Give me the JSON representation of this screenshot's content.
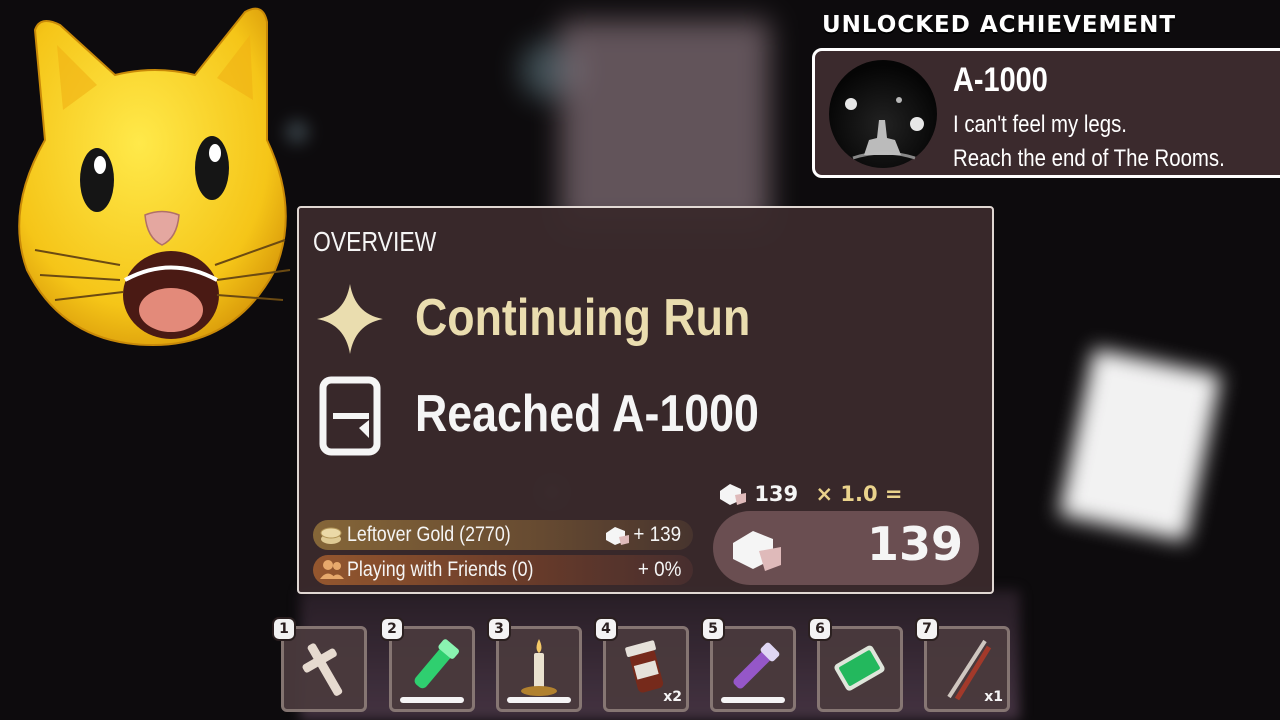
{
  "achievement": {
    "header": "UNLOCKED ACHIEVEMENT",
    "name": "A-1000",
    "line1": "I can't feel my legs.",
    "line2": "Reach the end of The Rooms."
  },
  "overview": {
    "title": "OVERVIEW",
    "rows": [
      {
        "label": "Continuing Run",
        "icon": "sparkle-icon",
        "color": "#f4e6b6"
      },
      {
        "label": "Reached A-1000",
        "icon": "door-icon",
        "color": "#ffffff"
      }
    ],
    "bonuses": [
      {
        "label": "Leftover Gold (2770)",
        "value": "+ 139",
        "icon": "gold-coins-icon"
      },
      {
        "label": "Playing with Friends (0)",
        "value": "+ 0%",
        "icon": "friends-icon"
      }
    ],
    "calc_base": "139",
    "calc_multiplier": "× 1.0 =",
    "total": "139"
  },
  "hotbar": [
    {
      "num": "1",
      "icon": "crucifix-icon",
      "count": "",
      "has_bar": false
    },
    {
      "num": "2",
      "icon": "green-flashlight-icon",
      "count": "",
      "has_bar": true
    },
    {
      "num": "3",
      "icon": "candle-icon",
      "count": "",
      "has_bar": true
    },
    {
      "num": "4",
      "icon": "pill-bottle-icon",
      "count": "x2",
      "has_bar": false
    },
    {
      "num": "5",
      "icon": "purple-flashlight-icon",
      "count": "",
      "has_bar": true
    },
    {
      "num": "6",
      "icon": "green-battery-icon",
      "count": "",
      "has_bar": false
    },
    {
      "num": "7",
      "icon": "lockpick-icon",
      "count": "x1",
      "has_bar": false
    }
  ],
  "colors": {
    "panel_bg": "#3a2a2c",
    "accent_gold": "#f3dc92",
    "gold_bonus_bg": "#7a5a34",
    "friends_bonus_bg": "#8a4a2a"
  }
}
